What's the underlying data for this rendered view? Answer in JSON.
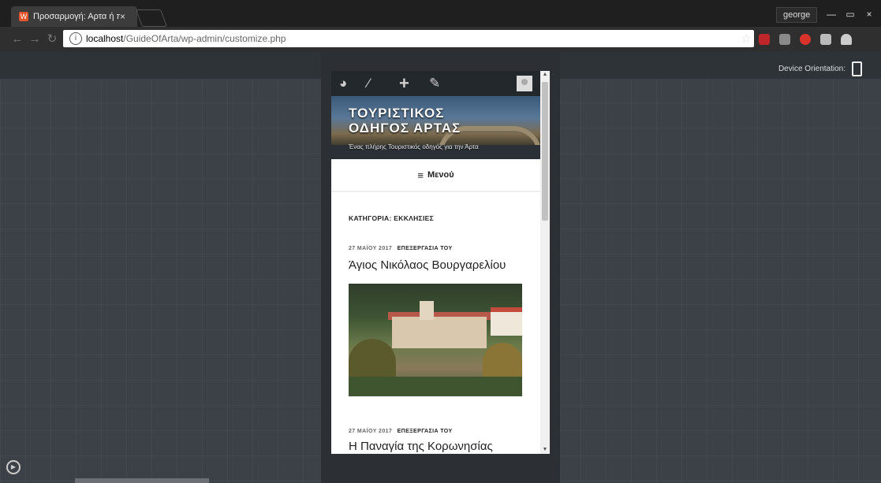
{
  "browser": {
    "tab_title": "Προσαρμογή: Αρτα ή πε",
    "tab_close": "×",
    "favicon": "wp-icon",
    "user": "george",
    "window_controls": [
      "—",
      "▭",
      "×"
    ],
    "url_host": "localhost",
    "url_path": "/GuideOfArta/wp-admin/customize.php",
    "star": "☆"
  },
  "customizer": {
    "orientation_label": "Device Orientation:",
    "orientation_icon": "phone-portrait-icon"
  },
  "site": {
    "title": "ΤΟΥΡΙΣΤΙΚΟΣ\nΟΔΗΓΟΣ ΑΡΤΑΣ",
    "description": "Ένας πλήρης Τουριστικός οδηγός για την Άρτα",
    "menu_label": "Μενού",
    "menu_icon": "≡",
    "archive_title": "ΚΑΤΗΓΟΡΙΑ: ΕΚΚΛΗΣΙΕΣ"
  },
  "posts": [
    {
      "date": "27 ΜΑΪΟΥ 2017",
      "edit": "ΕΠΕΞΕΡΓΑΣΙΑ ΤΟΥ",
      "title": "Άγιος Νικόλαος Βουργαρελίου"
    },
    {
      "date": "27 ΜΑΪΟΥ 2017",
      "edit": "ΕΠΕΞΕΡΓΑΣΙΑ ΤΟΥ",
      "title": "Η Παναγία της Κορωνησίας"
    }
  ],
  "colors": {
    "admin_bar": "#23282d",
    "canvas": "#3c4147",
    "accent_tab_icon": "#e0552c"
  }
}
